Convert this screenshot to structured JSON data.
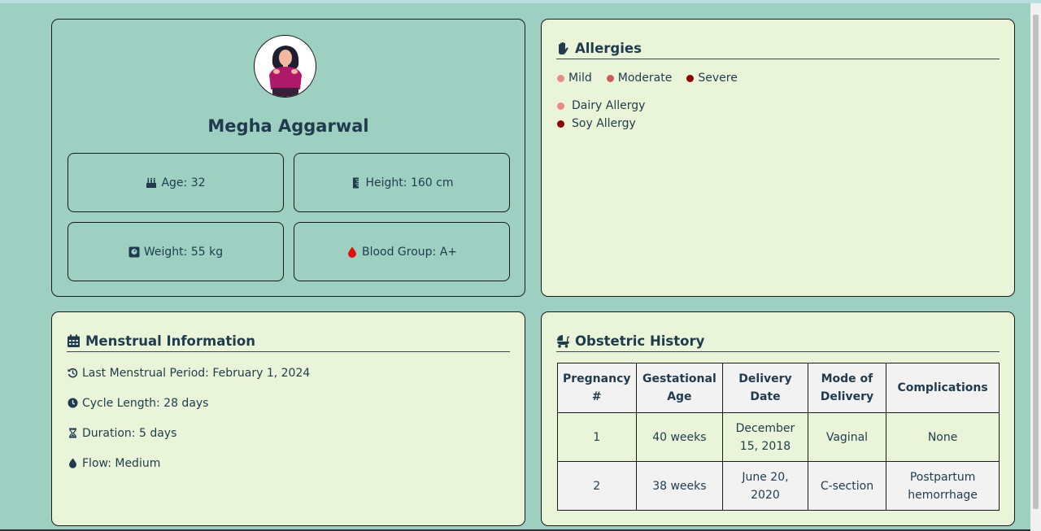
{
  "profile": {
    "name": "Megha Aggarwal",
    "age": "Age: 32",
    "height": "Height: 160 cm",
    "weight": "Weight: 55 kg",
    "blood_group": "Blood Group: A+"
  },
  "allergies": {
    "title": "Allergies",
    "legend": [
      {
        "label": "Mild",
        "color": "#e88a8a"
      },
      {
        "label": "Moderate",
        "color": "#cc5b5b"
      },
      {
        "label": "Severe",
        "color": "#8b0000"
      }
    ],
    "items": [
      {
        "label": "Dairy Allergy",
        "color": "#e88a8a"
      },
      {
        "label": "Soy Allergy",
        "color": "#8b0000"
      }
    ]
  },
  "menstrual": {
    "title": "Menstrual Information",
    "last_period": "Last Menstrual Period: February 1, 2024",
    "cycle_length": "Cycle Length: 28 days",
    "duration": "Duration: 5 days",
    "flow": "Flow: Medium"
  },
  "obstetric": {
    "title": "Obstetric History",
    "headers": [
      "Pregnancy #",
      "Gestational Age",
      "Delivery Date",
      "Mode of Delivery",
      "Complications"
    ],
    "rows": [
      [
        "1",
        "40 weeks",
        "December 15, 2018",
        "Vaginal",
        "None"
      ],
      [
        "2",
        "38 weeks",
        "June 20, 2020",
        "C-section",
        "Postpartum hemorrhage"
      ]
    ]
  },
  "colors": {
    "background": "#9ed0c2",
    "card": "#eaf4d8",
    "text": "#1f3b4d",
    "blood_drop": "#e01010"
  }
}
